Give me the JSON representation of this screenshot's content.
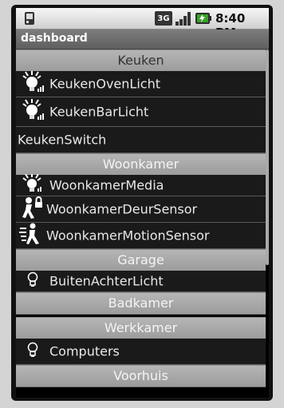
{
  "status_bar": {
    "network_label": "3G",
    "time": "8:40 PM",
    "icons": [
      "sim-card-icon",
      "3g-network-icon",
      "signal-strength-icon",
      "battery-charging-icon"
    ]
  },
  "app": {
    "title": "dashboard"
  },
  "sections": [
    {
      "header": "Keuken",
      "items": [
        {
          "label": "KeukenOvenLicht",
          "icon": "lightbulb-on-icon"
        },
        {
          "label": "KeukenBarLicht",
          "icon": "lightbulb-on-icon"
        },
        {
          "label": "KeukenSwitch",
          "icon": ""
        }
      ]
    },
    {
      "header": "Woonkamer",
      "items": [
        {
          "label": "WoonkamerMedia",
          "icon": "lightbulb-on-icon"
        },
        {
          "label": "WoonkamerDeurSensor",
          "icon": "door-sensor-icon"
        },
        {
          "label": "WoonkamerMotionSensor",
          "icon": "motion-sensor-icon"
        }
      ]
    },
    {
      "header": "Garage",
      "items": [
        {
          "label": "BuitenAchterLicht",
          "icon": "lightbulb-icon"
        }
      ]
    },
    {
      "header": "Badkamer",
      "items": []
    },
    {
      "header": "Werkkamer",
      "items": [
        {
          "label": "Computers",
          "icon": "lightbulb-icon"
        }
      ]
    },
    {
      "header": "Voorhuis",
      "items": []
    }
  ],
  "colors": {
    "header_bg": "#a8a8a8",
    "item_bg": "#1a1a1a",
    "item_text": "#e9e9e9",
    "status_bar_bg": "#e6e6e6"
  }
}
